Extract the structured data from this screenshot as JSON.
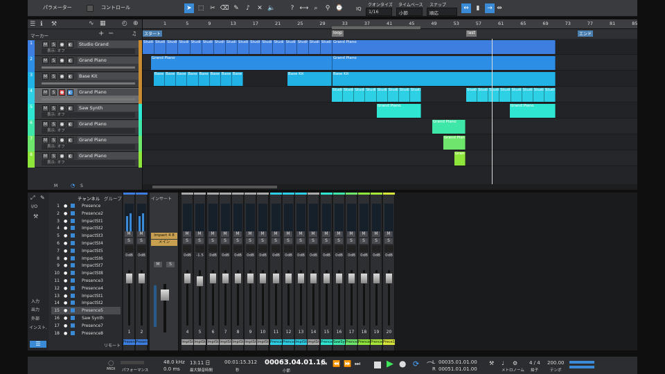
{
  "toolbar": {
    "parameters_label": "パラメーター",
    "control_label": "コントロール",
    "iq_label": "IQ",
    "quantize_label": "クオンタイズ",
    "quantize_value": "1/16",
    "timebase_label": "タイムベース",
    "timebase_value": "小節",
    "snap_label": "スナップ",
    "snap_value": "順応"
  },
  "track_header": {
    "marker_label": "マーカー",
    "mute_label": "M",
    "solo_label": "S",
    "tracks": [
      {
        "num": "1",
        "name": "Studio Grand",
        "sub": "表示: オフ",
        "color": "#3c7fe0"
      },
      {
        "num": "2",
        "name": "Grand Piano",
        "sub": "",
        "color": "#2d8ee6"
      },
      {
        "num": "3",
        "name": "Base Kit",
        "sub": "",
        "color": "#22b3e6"
      },
      {
        "num": "4",
        "name": "Grand Piano",
        "sub": "",
        "color": "#2ed0e6"
      },
      {
        "num": "5",
        "name": "Saw Synth",
        "sub": "表示: オフ",
        "color": "#2ee6d2"
      },
      {
        "num": "6",
        "name": "Grand Piano",
        "sub": "表示: オフ",
        "color": "#3ee6a8"
      },
      {
        "num": "7",
        "name": "Grand Piano",
        "sub": "表示: オフ",
        "color": "#6ee66b"
      },
      {
        "num": "8",
        "name": "Grand Piano",
        "sub": "表示: オフ",
        "color": "#8ee63a"
      }
    ]
  },
  "ruler": {
    "bars": [
      "1",
      "5",
      "9",
      "13",
      "17",
      "21",
      "25",
      "29",
      "33",
      "37",
      "41",
      "45",
      "49",
      "53",
      "57",
      "61",
      "65",
      "69",
      "73",
      "77",
      "81",
      "85",
      "89"
    ],
    "markers": {
      "start": "スタート",
      "loop": "loop",
      "last": "last",
      "end": "エンド"
    }
  },
  "clips": {
    "studio_grand": "Studi",
    "grand_piano": "Grand Piano",
    "grand_short": "Granc",
    "base_kit": "Base Kit",
    "base": "Base"
  },
  "mixer": {
    "channel_tab": "チャンネル",
    "group_tab": "グループ",
    "io_label": "I/O",
    "insert_label": "インサート",
    "input_label": "入力",
    "output_label": "出力",
    "external_label": "外部",
    "instrument_label": "インスト.",
    "remote_label": "リモート",
    "main_name": "Impact 4 8",
    "main_sub": "メイン",
    "channel_list": [
      "Presence",
      "Presence2",
      "ImpactSt1",
      "ImpactSt2",
      "ImpactSt3",
      "ImpactSt4",
      "ImpactSt5",
      "ImpactSt6",
      "ImpactSt7",
      "ImpactSt8",
      "Presence3",
      "Presence4",
      "ImpactSt1",
      "ImpactSt2",
      "Presence5",
      "Saw Synth",
      "Presence7",
      "Presence8"
    ],
    "channel_list_nums": [
      "1",
      "2",
      "3",
      "4",
      "5",
      "6",
      "7",
      "8",
      "9",
      "10",
      "11",
      "12",
      "13",
      "14",
      "15",
      "16",
      "17",
      "18"
    ],
    "strips": [
      {
        "num": "1",
        "name": "Presenc",
        "vol": "0dB",
        "color": "#3c7fe0"
      },
      {
        "num": "2",
        "name": "Presenc",
        "vol": "0dB",
        "color": "#3c7fe0"
      },
      {
        "num": "3",
        "name": "ImpactSt 1",
        "vol": "0dB",
        "color": "#4a8be0"
      },
      {
        "num": "4",
        "name": "ImptSt",
        "vol": "0dB",
        "color": "#aaaaaa"
      },
      {
        "num": "5",
        "name": "ImptSt",
        "vol": "-1.5",
        "color": "#aaaaaa"
      },
      {
        "num": "6",
        "name": "ImptSt",
        "vol": "0dB",
        "color": "#aaaaaa"
      },
      {
        "num": "7",
        "name": "ImptSt",
        "vol": "0dB",
        "color": "#aaaaaa"
      },
      {
        "num": "8",
        "name": "ImptSt",
        "vol": "0dB",
        "color": "#aaaaaa"
      },
      {
        "num": "9",
        "name": "ImptSt",
        "vol": "0dB",
        "color": "#aaaaaa"
      },
      {
        "num": "10",
        "name": "ImptSt",
        "vol": "0dB",
        "color": "#aaaaaa"
      },
      {
        "num": "11",
        "name": "Prence",
        "vol": "0dB",
        "color": "#2ed0e6"
      },
      {
        "num": "12",
        "name": "Prence",
        "vol": "0dB",
        "color": "#2ed0e6"
      },
      {
        "num": "13",
        "name": "ImptSt",
        "vol": "0dB",
        "color": "#2ed0e6"
      },
      {
        "num": "14",
        "name": "ImptSt",
        "vol": "0dB",
        "color": "#aaaaaa"
      },
      {
        "num": "15",
        "name": "Prence",
        "vol": "0dB",
        "color": "#2ee6d2"
      },
      {
        "num": "16",
        "name": "SawSyn",
        "vol": "0dB",
        "color": "#3ee6a8"
      },
      {
        "num": "17",
        "name": "Prence",
        "vol": "0dB",
        "color": "#6ee66b"
      },
      {
        "num": "18",
        "name": "Prence",
        "vol": "0dB",
        "color": "#8ee63a"
      },
      {
        "num": "19",
        "name": "Prence",
        "vol": "0dB",
        "color": "#a8e63a"
      },
      {
        "num": "20",
        "name": "Prece1",
        "vol": "0dB",
        "color": "#d8e63a"
      }
    ]
  },
  "transport": {
    "midi_label": "MIDI",
    "performance_label": "パフォーマンス",
    "sample_rate": "48.0 kHz",
    "latency": "0.0 ms",
    "record_max": "13:11 日",
    "record_max_label": "最大録音時間",
    "seconds": "00:01:15.312",
    "seconds_label": "秒",
    "position": "00063.04.01.16",
    "position_label": "小節",
    "loop_start": "00035.01.01.00",
    "loop_end": "00051.01.01.00",
    "loop_start_label": "L",
    "loop_end_label": "R",
    "metronome_label": "メトロノーム",
    "signature": "4 / 4",
    "signature_label": "拍子",
    "tempo": "200.00",
    "tempo_label": "テンポ"
  }
}
